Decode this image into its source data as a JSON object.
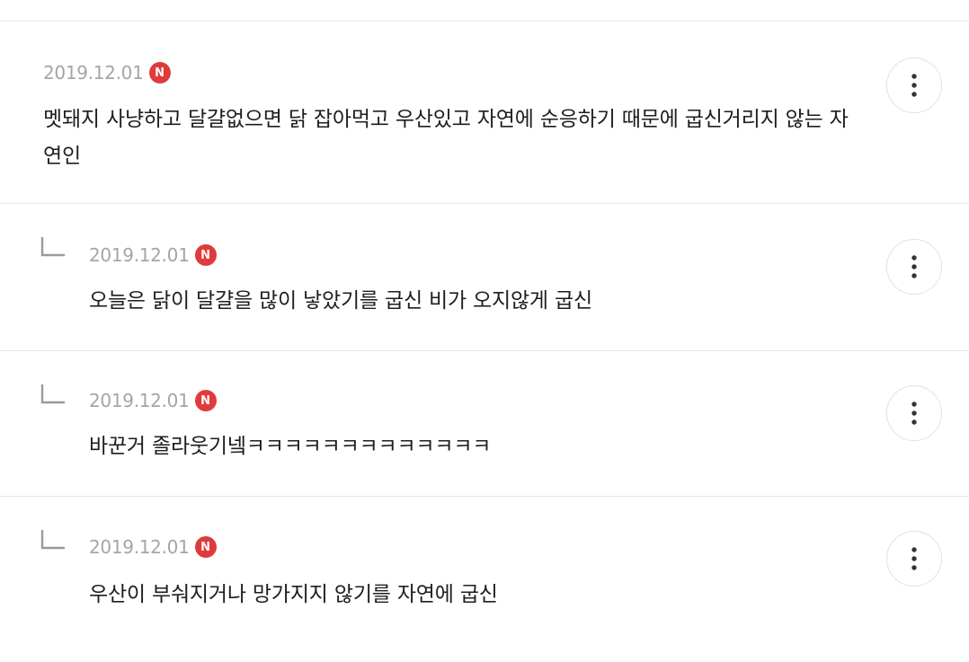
{
  "comments": [
    {
      "date": "2019.12.01",
      "badge": "N",
      "text": "멧돼지 사냥하고 달걀없으면 닭 잡아먹고 우산있고 자연에 순응하기 때문에 굽신거리지 않는 자연인",
      "more_icon": "more-vertical-icon"
    },
    {
      "date": "2019.12.01",
      "badge": "N",
      "text": "오늘은 닭이 달걀을 많이 낳았기를 굽신 비가 오지않게 굽신",
      "reply_icon": "reply-arrow-icon",
      "more_icon": "more-vertical-icon"
    },
    {
      "date": "2019.12.01",
      "badge": "N",
      "text": "바꾼거 졸라웃기넼ㅋㅋㅋㅋㅋㅋㅋㅋㅋㅋㅋㅋㅋ",
      "reply_icon": "reply-arrow-icon",
      "more_icon": "more-vertical-icon"
    },
    {
      "date": "2019.12.01",
      "badge": "N",
      "text": "우산이 부숴지거나 망가지지 않기를 자연에 굽신",
      "reply_icon": "reply-arrow-icon",
      "more_icon": "more-vertical-icon"
    }
  ],
  "colors": {
    "badge": "#e03b3b",
    "date": "#a5a5a5",
    "divider": "#e6e6e6",
    "text": "#1e1e1e"
  }
}
